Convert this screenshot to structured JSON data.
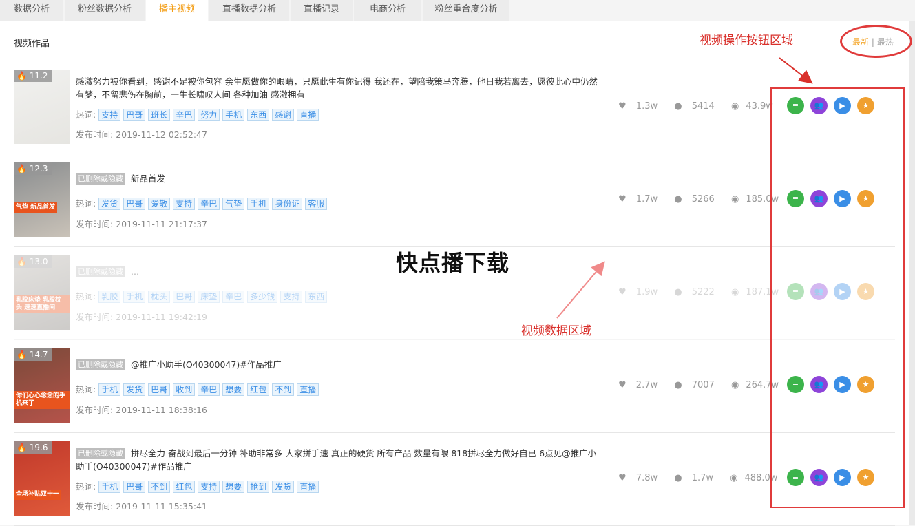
{
  "tabs": [
    {
      "label": "数据分析",
      "active": false,
      "new": false,
      "width": 92
    },
    {
      "label": "粉丝数据分析",
      "active": false,
      "new": false,
      "width": 116
    },
    {
      "label": "播主视频",
      "active": true,
      "new": false,
      "width": 90
    },
    {
      "label": "直播数据分析",
      "active": false,
      "new": true,
      "width": 116
    },
    {
      "label": "直播记录",
      "active": false,
      "new": true,
      "width": 90
    },
    {
      "label": "电商分析",
      "active": false,
      "new": true,
      "width": 98
    },
    {
      "label": "粉丝重合度分析",
      "active": false,
      "new": true,
      "width": 126
    }
  ],
  "section_title": "视频作品",
  "sort": {
    "latest": "最新",
    "divider": "|",
    "hottest": "最热"
  },
  "labels": {
    "hot_words": "热词:",
    "publish_time": "发布时间:",
    "deleted_badge": "已删除或隐藏"
  },
  "videos": [
    {
      "score": "11.2",
      "deleted": false,
      "description": "感激努力被你看到，感谢不足被你包容 余生愿做你的眼睛，只愿此生有你记得 我还在，望陪我策马奔腾，他日我若离去，愿彼此心中仍然有梦，不留悲伤在胸前，一生长啸叹人间 各种加油 感激拥有",
      "tags": [
        "支持",
        "巴哥",
        "班长",
        "辛巴",
        "努力",
        "手机",
        "东西",
        "感谢",
        "直播"
      ],
      "time": "2019-11-12 02:52:47",
      "likes": "1.3w",
      "comments": "5414",
      "views": "43.9w",
      "thumb_colors": [
        "#f1f1ef",
        "#e6e5e1"
      ],
      "caption": "",
      "faded": false
    },
    {
      "score": "12.3",
      "deleted": true,
      "description": "新品首发",
      "tags": [
        "发货",
        "巴哥",
        "爱敬",
        "支持",
        "辛巴",
        "气垫",
        "手机",
        "身份证",
        "客服"
      ],
      "time": "2019-11-11 21:17:37",
      "likes": "1.7w",
      "comments": "5266",
      "views": "185.0w",
      "thumb_colors": [
        "#8a8d8f",
        "#c9c2b8"
      ],
      "caption": "气垫 新品首发",
      "faded": false
    },
    {
      "score": "13.0",
      "deleted": true,
      "description": "...",
      "tags": [
        "乳胶",
        "手机",
        "枕头",
        "巴哥",
        "床垫",
        "辛巴",
        "多少钱",
        "支持",
        "东西"
      ],
      "time": "2019-11-11 19:42:19",
      "likes": "1.9w",
      "comments": "5222",
      "views": "187.1w",
      "thumb_colors": [
        "#b9b4ad",
        "#7f7a74"
      ],
      "caption": "乳胶床垫 乳胶枕头 速速直播间",
      "faded": true
    },
    {
      "score": "14.7",
      "deleted": true,
      "description": "@推广小助手(O40300047)#作品推广",
      "tags": [
        "手机",
        "发货",
        "巴哥",
        "收到",
        "辛巴",
        "想要",
        "红包",
        "不到",
        "直播"
      ],
      "time": "2019-11-11 18:38:16",
      "likes": "2.7w",
      "comments": "7007",
      "views": "264.7w",
      "thumb_colors": [
        "#7a4a3a",
        "#b5534a"
      ],
      "caption": "你们心心念念的手机来了",
      "faded": false
    },
    {
      "score": "19.6",
      "deleted": true,
      "description": "拼尽全力 奋战到最后一分钟 补助非常多 大家拼手速 真正的硬货 所有产品 数量有限 818拼尽全力做好自已 6点见@推广小助手(O40300047)#作品推广",
      "tags": [
        "手机",
        "巴哥",
        "不到",
        "红包",
        "支持",
        "想要",
        "抢到",
        "发货",
        "直播"
      ],
      "time": "2019-11-11 15:35:41",
      "likes": "7.8w",
      "comments": "1.7w",
      "views": "488.0w",
      "thumb_colors": [
        "#c0392b",
        "#e05a3a"
      ],
      "caption": "全场补贴双十一",
      "faded": false
    }
  ],
  "action_buttons": [
    {
      "name": "detail",
      "icon": "list-icon",
      "color": "#3cb44b",
      "glyph": "≡"
    },
    {
      "name": "audience",
      "icon": "users-icon",
      "color": "#8e44d9",
      "glyph": "👥"
    },
    {
      "name": "play",
      "icon": "play-icon",
      "color": "#3a8ee6",
      "glyph": "▶"
    },
    {
      "name": "favorite",
      "icon": "star-icon",
      "color": "#f0a030",
      "glyph": "★"
    }
  ],
  "annotations": {
    "buttons_area": "视频操作按钮区域",
    "data_area": "视频数据区域",
    "watermark": "快点播下载"
  }
}
